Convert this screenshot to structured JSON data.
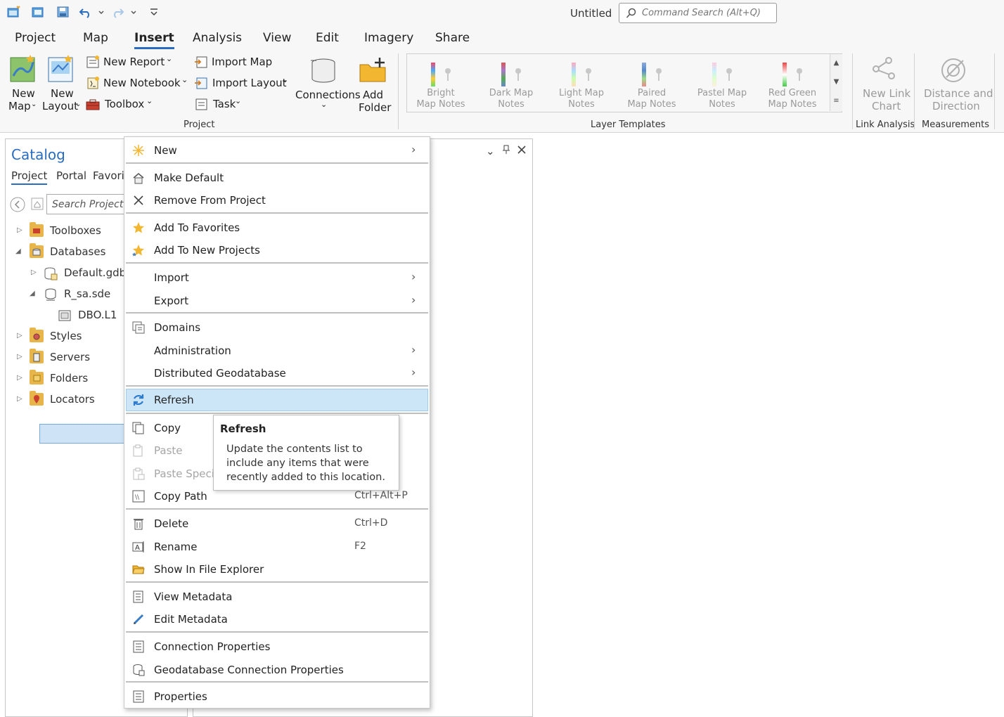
{
  "title_bar": {
    "doc_title": "Untitled",
    "search_placeholder": "Command Search (Alt+Q)",
    "quick_access_icons": [
      "new-project-icon",
      "open-project-icon",
      "save-project-icon",
      "undo-icon",
      "dropdown-icon",
      "redo-icon",
      "dropdown-icon",
      "customize-icon"
    ]
  },
  "menu_tabs": [
    "Project",
    "Map",
    "Insert",
    "Analysis",
    "View",
    "Edit",
    "Imagery",
    "Share"
  ],
  "active_tab": "Insert",
  "ribbon": {
    "project_group": {
      "label": "Project",
      "new_map": [
        "New",
        "Map"
      ],
      "new_layout": [
        "New",
        "Layout"
      ],
      "new_report": "New Report",
      "new_notebook": "New Notebook",
      "toolbox": "Toolbox",
      "import_map": "Import Map",
      "import_layout": "Import Layout",
      "task": "Task",
      "connections": "Connections",
      "add_folder": [
        "Add",
        "Folder"
      ]
    },
    "layer_templates": {
      "label": "Layer Templates",
      "items": [
        {
          "l1": "Bright",
          "l2": "Map Notes"
        },
        {
          "l1": "Dark Map",
          "l2": "Notes"
        },
        {
          "l1": "Light Map",
          "l2": "Notes"
        },
        {
          "l1": "Paired",
          "l2": "Map Notes"
        },
        {
          "l1": "Pastel Map",
          "l2": "Notes"
        },
        {
          "l1": "Red Green",
          "l2": "Map Notes"
        }
      ]
    },
    "link_analysis": {
      "label": "Link Analysis",
      "l1": "New Link",
      "l2": "Chart"
    },
    "measurements": {
      "label": "Measurements",
      "l1": "Distance and",
      "l2": "Direction"
    }
  },
  "catalog": {
    "title": "Catalog",
    "tabs": [
      "Project",
      "Portal",
      "Favori"
    ],
    "search_placeholder": "Search Project",
    "tree": [
      {
        "label": "Toolboxes"
      },
      {
        "label": "Databases"
      },
      {
        "label": "Default.gdb"
      },
      {
        "label": "R_sa.sde"
      },
      {
        "label": "DBO.L1"
      },
      {
        "label": "Styles"
      },
      {
        "label": "Servers"
      },
      {
        "label": "Folders"
      },
      {
        "label": "Locators"
      }
    ]
  },
  "context_menu": {
    "items": [
      {
        "label": "New"
      },
      {
        "label": "Make Default"
      },
      {
        "label": "Remove From Project"
      },
      {
        "label": "Add To Favorites"
      },
      {
        "label": "Add To New Projects"
      },
      {
        "label": "Import"
      },
      {
        "label": "Export"
      },
      {
        "label": "Domains"
      },
      {
        "label": "Administration"
      },
      {
        "label": "Distributed Geodatabase"
      },
      {
        "label": "Refresh"
      },
      {
        "label": "Copy"
      },
      {
        "label": "Paste"
      },
      {
        "label": "Paste Special"
      },
      {
        "label": "Copy Path",
        "shortcut": "Ctrl+Alt+P"
      },
      {
        "label": "Delete",
        "shortcut": "Ctrl+D"
      },
      {
        "label": "Rename",
        "shortcut": "F2"
      },
      {
        "label": "Show In File Explorer"
      },
      {
        "label": "View Metadata"
      },
      {
        "label": "Edit Metadata"
      },
      {
        "label": "Connection Properties"
      },
      {
        "label": "Geodatabase Connection Properties"
      },
      {
        "label": "Properties"
      }
    ]
  },
  "tooltip": {
    "title": "Refresh",
    "body": "Update the contents list to include any items that were recently added to this location."
  },
  "colors": {
    "accent": "#2a6dc0",
    "highlight": "#cde6f7",
    "selection": "#cfe3f7"
  }
}
